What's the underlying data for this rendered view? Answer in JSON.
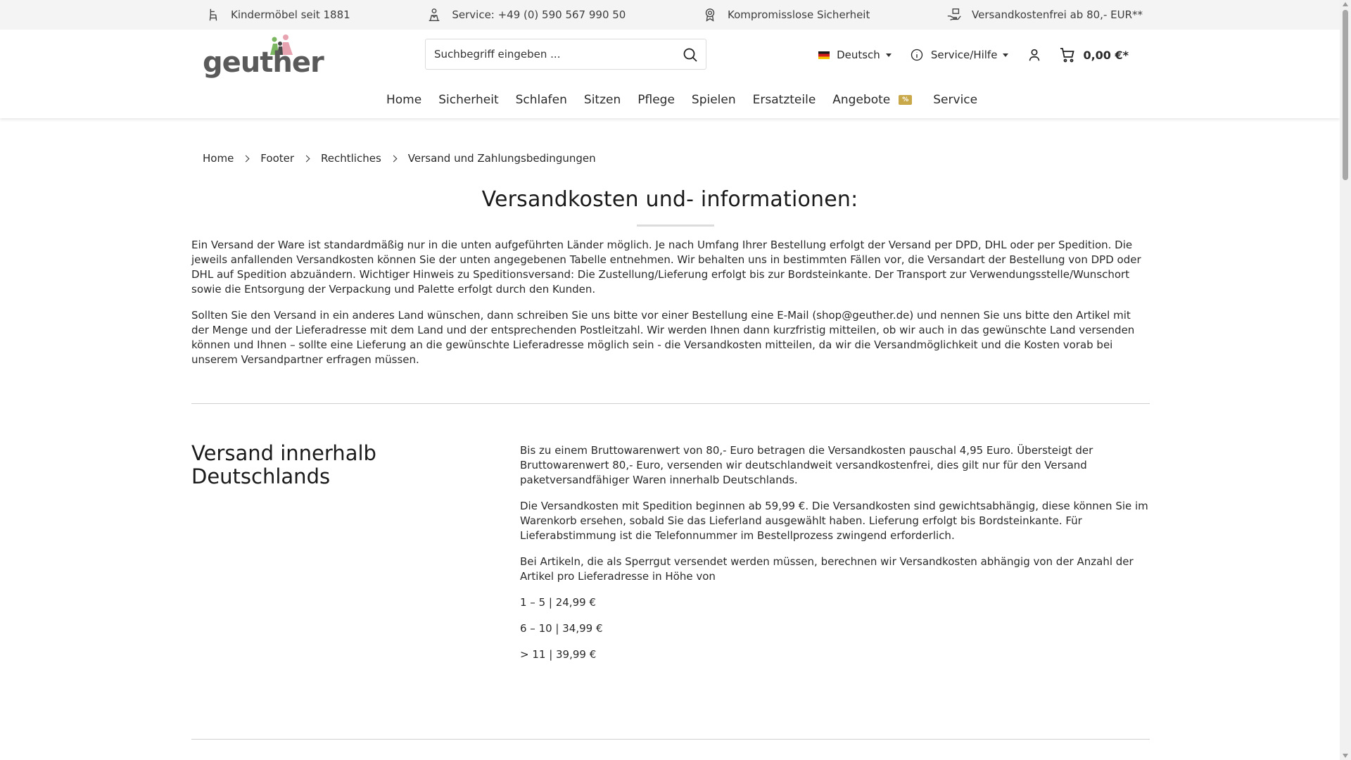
{
  "topbar": {
    "items": [
      {
        "label": "Kindermöbel seit 1881",
        "icon": "high-chair-icon"
      },
      {
        "label": "Service: +49 (0) 590 567 990 50",
        "icon": "service-person-icon"
      },
      {
        "label": "Kompromisslose Sicherheit",
        "icon": "award-badge-icon"
      },
      {
        "label": "Versandkostenfrei ab 80,- EUR**",
        "icon": "hand-package-icon"
      }
    ]
  },
  "header": {
    "logo_text": "geuther",
    "search": {
      "placeholder": "Suchbegriff eingeben ..."
    },
    "language": {
      "label": "Deutsch"
    },
    "service_label": "Service/Hilfe",
    "cart_total": "0,00 €*"
  },
  "nav": {
    "items": [
      "Home",
      "Sicherheit",
      "Schlafen",
      "Sitzen",
      "Pflege",
      "Spielen",
      "Ersatzteile",
      "Angebote",
      "Service"
    ],
    "sale_badge": "%"
  },
  "breadcrumb": [
    "Home",
    "Footer",
    "Rechtliches",
    "Versand und Zahlungsbedingungen"
  ],
  "main": {
    "title": "Versandkosten und- informationen:",
    "intro": [
      "Ein Versand der Ware ist standardmäßig nur in die unten aufgeführten Länder möglich. Je nach Umfang Ihrer Bestellung erfolgt der Versand per DPD, DHL oder per Spedition. Die jeweils anfallenden Versandkosten können Sie der unten angegebenen Tabelle entnehmen. Wir behalten uns in bestimmten Fällen vor, die Versandart der Bestellung von DPD oder DHL auf Spedition abzuändern. Wichtiger Hinweis zu Speditionsversand: Die Zustellung/Lieferung erfolgt bis zur Bordsteinkante. Der Transport zur Verwendungsstelle/Wunschort sowie die Entsorgung der Verpackung und Palette erfolgt durch den Kunden.",
      "Sollten Sie den Versand in ein anderes Land wünschen, dann schreiben Sie uns bitte vor einer Bestellung eine E-Mail (shop@geuther.de) und nennen Sie uns bitte den Artikel mit der Menge und der Lieferadresse mit dem Land und der entsprechenden Postleitzahl. Wir werden Ihnen dann kurzfristig mitteilen, ob wir auch in das gewünschte Land versenden können und Ihnen – sollte eine Lieferung an die gewünschte Lieferadresse möglich sein - die Versandkosten mitteilen, da wir die Versandmöglichkeit und die Kosten vorab bei unserem Versandpartner erfragen müssen."
    ],
    "section_title": "Versand innerhalb Deutschlands",
    "section_paragraphs": [
      "Bis zu einem Bruttowarenwert von 80,- Euro betragen die Versandkosten pauschal 4,95 Euro. Übersteigt der Bruttowarenwert 80,- Euro, versenden wir deutschlandweit versandkostenfrei, dies gilt nur für den Versand paketversandfähiger Waren innerhalb Deutschlands.",
      "Die Versandkosten mit Spedition beginnen ab 59,99 €. Die Versandkosten sind gewichtsabhängig, diese können Sie im Warenkorb ersehen, sobald Sie das Lieferland ausgewählt haben. Lieferung erfolgt bis Bordsteinkante. Für Lieferabstimmung ist die Telefonnummer im Bestellprozess zwingend erforderlich.",
      "Bei Artikeln, die als Sperrgut versendet werden müssen, berechnen wir Versandkosten abhängig von der Anzahl der Artikel pro Lieferadresse in Höhe von",
      "1 – 5 | 24,99 €",
      "6 – 10 | 34,99 €",
      "> 11 | 39,99 €"
    ]
  },
  "colors": {
    "topbar_bg": "#f4f4f4",
    "sale_badge": "#c9a84a",
    "logo_pink": "#e8a3b0",
    "logo_green": "#7bb661"
  }
}
